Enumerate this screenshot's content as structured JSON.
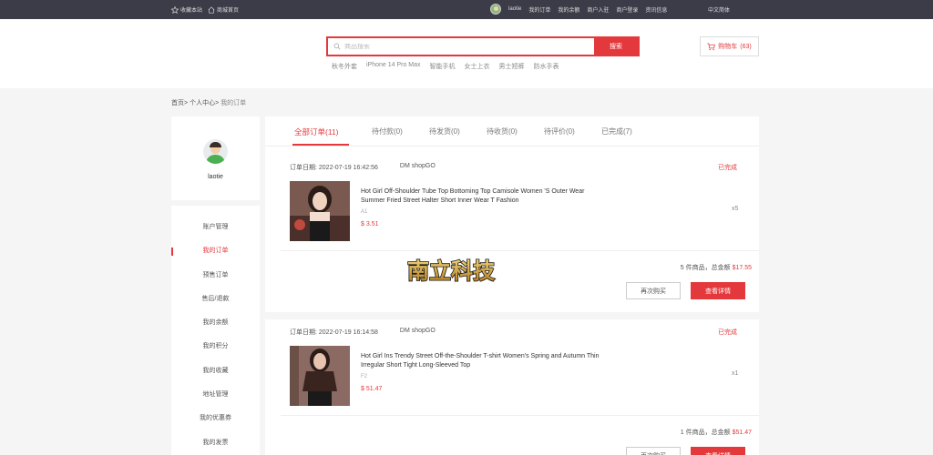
{
  "topbar": {
    "favorite": "收藏本站",
    "home": "商城首页",
    "username": "laotie",
    "links": [
      "我的订单",
      "我的余额",
      "商户入驻",
      "商户登录",
      "资讯信息"
    ],
    "language": "中文简体"
  },
  "search": {
    "placeholder": "商品搜索",
    "button": "搜索",
    "hot": [
      "秋冬外套",
      "iPhone 14 Pro Max",
      "智能手机",
      "女士上衣",
      "男士短裤",
      "防水手表"
    ]
  },
  "cart": {
    "label": "购物车",
    "count": "(63)"
  },
  "breadcrumb": {
    "home": "首页>",
    "center": "个人中心>",
    "current": "我的订单"
  },
  "profile": {
    "name": "laotie"
  },
  "menu": [
    "账户管理",
    "我的订单",
    "预售订单",
    "售后/退款",
    "我的余额",
    "我的积分",
    "我的收藏",
    "地址管理",
    "我的优惠券",
    "我的发票"
  ],
  "tabs": [
    "全部订单(11)",
    "待付款(0)",
    "待发货(0)",
    "待收货(0)",
    "待评价(0)",
    "已完成(7)"
  ],
  "watermark": {
    "text": "南立科技"
  },
  "orders": [
    {
      "date": "订单日期: 2022-07-19 16:42:56",
      "shop": "DM shopGO",
      "status": "已完成",
      "title": "Hot Girl Off-Shoulder Tube Top Bottoming Top Camisole Women 'S Outer Wear Summer Fried Street Halter Short Inner Wear T Fashion",
      "sku": "A1",
      "price": "$ 3.51",
      "qty": "x5",
      "total_prefix": "5 件商品，总金额",
      "total_amount": "$17.55",
      "rebuy": "再次购买",
      "detail": "查看详情"
    },
    {
      "date": "订单日期: 2022-07-19 16:14:58",
      "shop": "DM shopGO",
      "status": "已完成",
      "title": "Hot Girl Ins Trendy Street Off-the-Shoulder T-shirt Women's Spring and Autumn Thin Irregular Short Tight Long-Sleeved Top",
      "sku": "F2",
      "price": "$ 51.47",
      "qty": "x1",
      "total_prefix": "1 件商品，总金额",
      "total_amount": "$51.47",
      "rebuy": "再次购买",
      "detail": "查看详情"
    }
  ]
}
